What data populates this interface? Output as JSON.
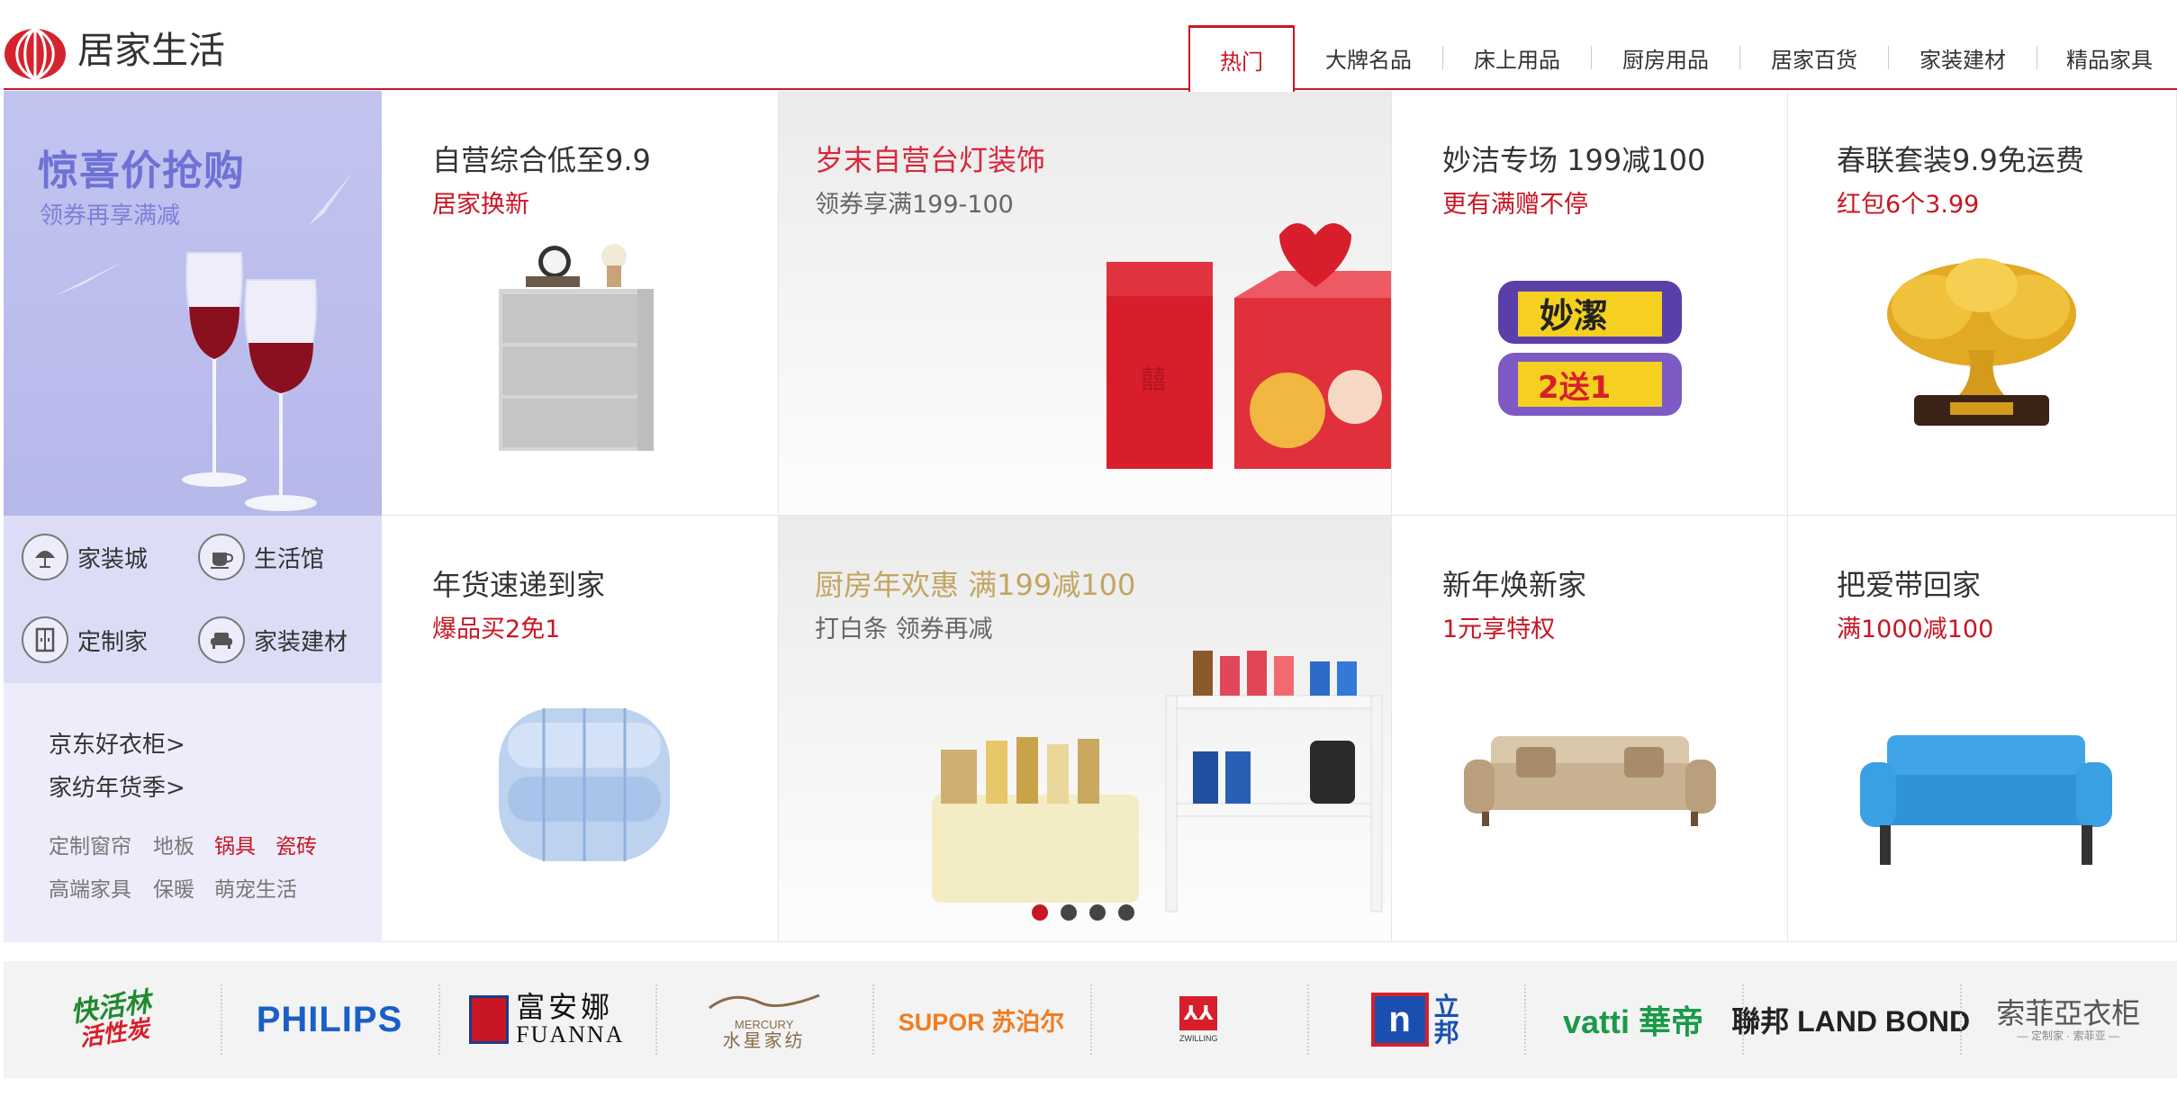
{
  "header": {
    "title": "居家生活",
    "tabs": [
      {
        "label": "热门",
        "active": true
      },
      {
        "label": "大牌名品",
        "active": false
      },
      {
        "label": "床上用品",
        "active": false
      },
      {
        "label": "厨房用品",
        "active": false
      },
      {
        "label": "居家百货",
        "active": false
      },
      {
        "label": "家装建材",
        "active": false
      },
      {
        "label": "精品家具",
        "active": false
      }
    ]
  },
  "promo": {
    "title": "惊喜价抢购",
    "subtitle": "领券再享满减"
  },
  "categories": [
    {
      "label": "家装城",
      "icon": "lamp-icon"
    },
    {
      "label": "生活馆",
      "icon": "cup-icon"
    },
    {
      "label": "定制家",
      "icon": "wardrobe-icon"
    },
    {
      "label": "家装建材",
      "icon": "sofa-icon"
    }
  ],
  "links": {
    "primary": [
      "京东好衣柜>",
      "家纺年货季>"
    ],
    "secondary_row1": [
      "定制窗帘",
      "地板",
      "锅具",
      "瓷砖"
    ],
    "secondary_row2": [
      "高端家具",
      "保暖",
      "萌宠生活"
    ]
  },
  "tiles": [
    {
      "title": "自营综合低至9.9",
      "subtitle": "居家换新"
    },
    {
      "title": "岁末自营台灯装饰",
      "subtitle": "领券享满199-100"
    },
    {
      "title": "妙洁专场 199减100",
      "subtitle": "更有满赠不停"
    },
    {
      "title": "春联套装9.9免运费",
      "subtitle": "红包6个3.99"
    },
    {
      "title": "年货速递到家",
      "subtitle": "爆品买2免1"
    },
    {
      "title": "厨房年欢惠 满199减100",
      "subtitle": "打白条 领券再减"
    },
    {
      "title": "新年焕新家",
      "subtitle": "1元享特权"
    },
    {
      "title": "把爱带回家",
      "subtitle": "满1000减100"
    }
  ],
  "product_text": {
    "miaojie_brand": "妙潔",
    "miaojie_offer": "2送1",
    "xi_char": "囍"
  },
  "carousel": {
    "count": 4,
    "active_index": 0
  },
  "brands": [
    {
      "name": "快活林 活性炭",
      "text_top": "快活林",
      "text_bottom": "活性炭"
    },
    {
      "name": "PHILIPS",
      "text": "PHILIPS"
    },
    {
      "name": "富安娜 FUANNA",
      "text_top": "富安娜",
      "text_bottom": "FUANNA"
    },
    {
      "name": "水星家纺 MERCURY",
      "text_top": "MERCURY",
      "text_bottom": "水星家纺"
    },
    {
      "name": "SUPOR 苏泊尔",
      "text": "SUPOR 苏泊尔"
    },
    {
      "name": "ZWILLING",
      "text": "ZWILLING"
    },
    {
      "name": "立邦",
      "text": "立邦"
    },
    {
      "name": "vatti 華帝",
      "text": "vatti 華帝"
    },
    {
      "name": "聯邦 LAND BOND",
      "text": "聯邦 LAND BOND"
    },
    {
      "name": "索菲亞衣柜",
      "text_top": "索菲亞衣柜",
      "text_bottom": "— 定制家 · 索菲亚 —"
    }
  ],
  "colors": {
    "accent": "#c81623",
    "promo_bg": "#b8bbeb",
    "promo_text": "#6e72d6",
    "category_bg": "#dcdcf6",
    "link_bg": "#ececfb",
    "brand_strip_bg": "#f3f3f3"
  }
}
